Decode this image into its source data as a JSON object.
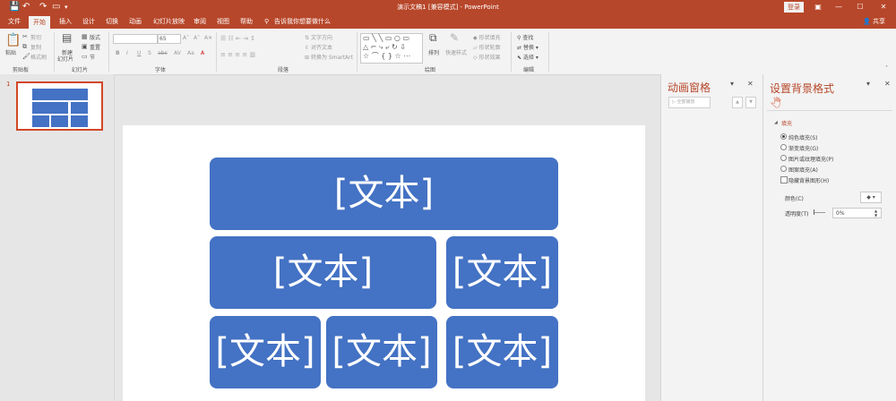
{
  "titlebar": {
    "title": "演示文稿1 [兼容模式] - PowerPoint",
    "login": "登录",
    "qat": {
      "save": "💾",
      "undo": "↶",
      "redo": "↷",
      "start": "▭"
    }
  },
  "tabs": {
    "file": "文件",
    "home": "开始",
    "insert": "插入",
    "design": "设计",
    "transitions": "切换",
    "animations": "动画",
    "slideshow": "幻灯片放映",
    "review": "审阅",
    "view": "视图",
    "help": "帮助",
    "tellme": "告诉我你想要做什么",
    "share": "共享"
  },
  "ribbon": {
    "clipboard": {
      "paste": "粘贴",
      "cut": "剪切",
      "copy": "复制",
      "format_painter": "格式刷",
      "label": "剪贴板"
    },
    "slides": {
      "new_slide": "新建",
      "new_slide2": "幻灯片",
      "layout": "版式",
      "reset": "重置",
      "section": "节",
      "label": "幻灯片"
    },
    "font": {
      "font_size": "65",
      "bold": "B",
      "italic": "I",
      "underline": "U",
      "strike": "S",
      "shadow": "abc",
      "spacing": "AV",
      "case": "Aa",
      "color": "A",
      "label": "字体"
    },
    "paragraph": {
      "text_direction": "文字方向",
      "align_text": "对齐文本",
      "smartart": "转换为 SmartArt",
      "label": "段落"
    },
    "drawing": {
      "arrange": "排列",
      "quick_styles": "快速样式",
      "shape_fill": "形状填充",
      "shape_outline": "形状轮廓",
      "shape_effects": "形状效果",
      "label": "绘图"
    },
    "editing": {
      "find": "查找",
      "replace": "替换",
      "select": "选择",
      "label": "编辑"
    }
  },
  "thumbs": {
    "number": "1"
  },
  "slide": {
    "boxes": [
      "[文本]",
      "[文本]",
      "[文本]",
      "[文本]",
      "[文本]",
      "[文本]"
    ],
    "color": "#4472c4"
  },
  "anim_pane": {
    "title": "动画窗格",
    "play_all": "全部播放",
    "up": "▲",
    "down": "▼"
  },
  "bg_pane": {
    "title": "设置背景格式",
    "fill_section": "填充",
    "options": [
      "纯色填充(S)",
      "渐变填充(G)",
      "图片或纹理填充(P)",
      "图案填充(A)"
    ],
    "hide_bg": "隐藏背景图形(H)",
    "color_label": "颜色(C)",
    "transparency_label": "透明度(T)",
    "transparency_value": "0%"
  },
  "colors": {
    "accent": "#b7472a",
    "shape": "#4472c4"
  }
}
